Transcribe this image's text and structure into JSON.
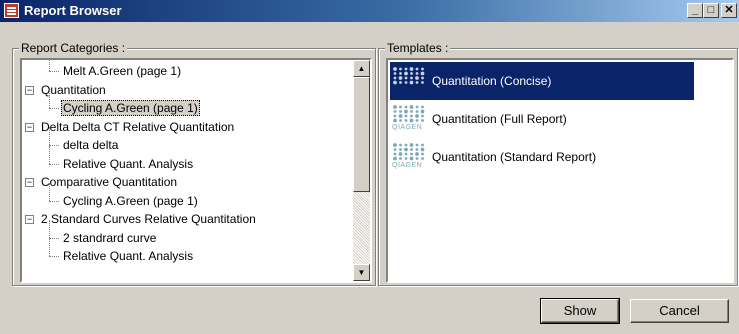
{
  "window": {
    "title": "Report Browser"
  },
  "titlebar_buttons": [
    "_",
    "□",
    "✕"
  ],
  "categories": {
    "label": "Report Categories :",
    "items": [
      {
        "text": "Melt A.Green (page 1)",
        "level": 1,
        "selected": false
      },
      {
        "text": "Quantitation",
        "level": 0,
        "selected": false,
        "expander": "−"
      },
      {
        "text": "Cycling A.Green (page 1)",
        "level": 1,
        "selected": true
      },
      {
        "text": "Delta Delta CT Relative Quantitation",
        "level": 0,
        "selected": false,
        "expander": "−"
      },
      {
        "text": "delta delta",
        "level": 1,
        "selected": false
      },
      {
        "text": "Relative Quant. Analysis",
        "level": 1,
        "selected": false
      },
      {
        "text": "Comparative Quantitation",
        "level": 0,
        "selected": false,
        "expander": "−"
      },
      {
        "text": "Cycling A.Green (page 1)",
        "level": 1,
        "selected": false
      },
      {
        "text": "2 Standard Curves Relative Quantitation",
        "level": 0,
        "selected": false,
        "expander": "−"
      },
      {
        "text": "2 standrard curve",
        "level": 1,
        "selected": false
      },
      {
        "text": "Relative Quant. Analysis",
        "level": 1,
        "selected": false
      }
    ]
  },
  "templates": {
    "label": "Templates :",
    "items": [
      {
        "text": "Quantitation (Concise)",
        "selected": true,
        "icon_text": ""
      },
      {
        "text": "Quantitation (Full Report)",
        "selected": false,
        "icon_text": "QIAGEN"
      },
      {
        "text": "Quantitation (Standard Report)",
        "selected": false,
        "icon_text": "QIAGEN"
      }
    ]
  },
  "buttons": {
    "show": "Show",
    "cancel": "Cancel"
  },
  "colors": {
    "selection": "#0a246a",
    "qiagen_dots": "#7fa7b7"
  }
}
